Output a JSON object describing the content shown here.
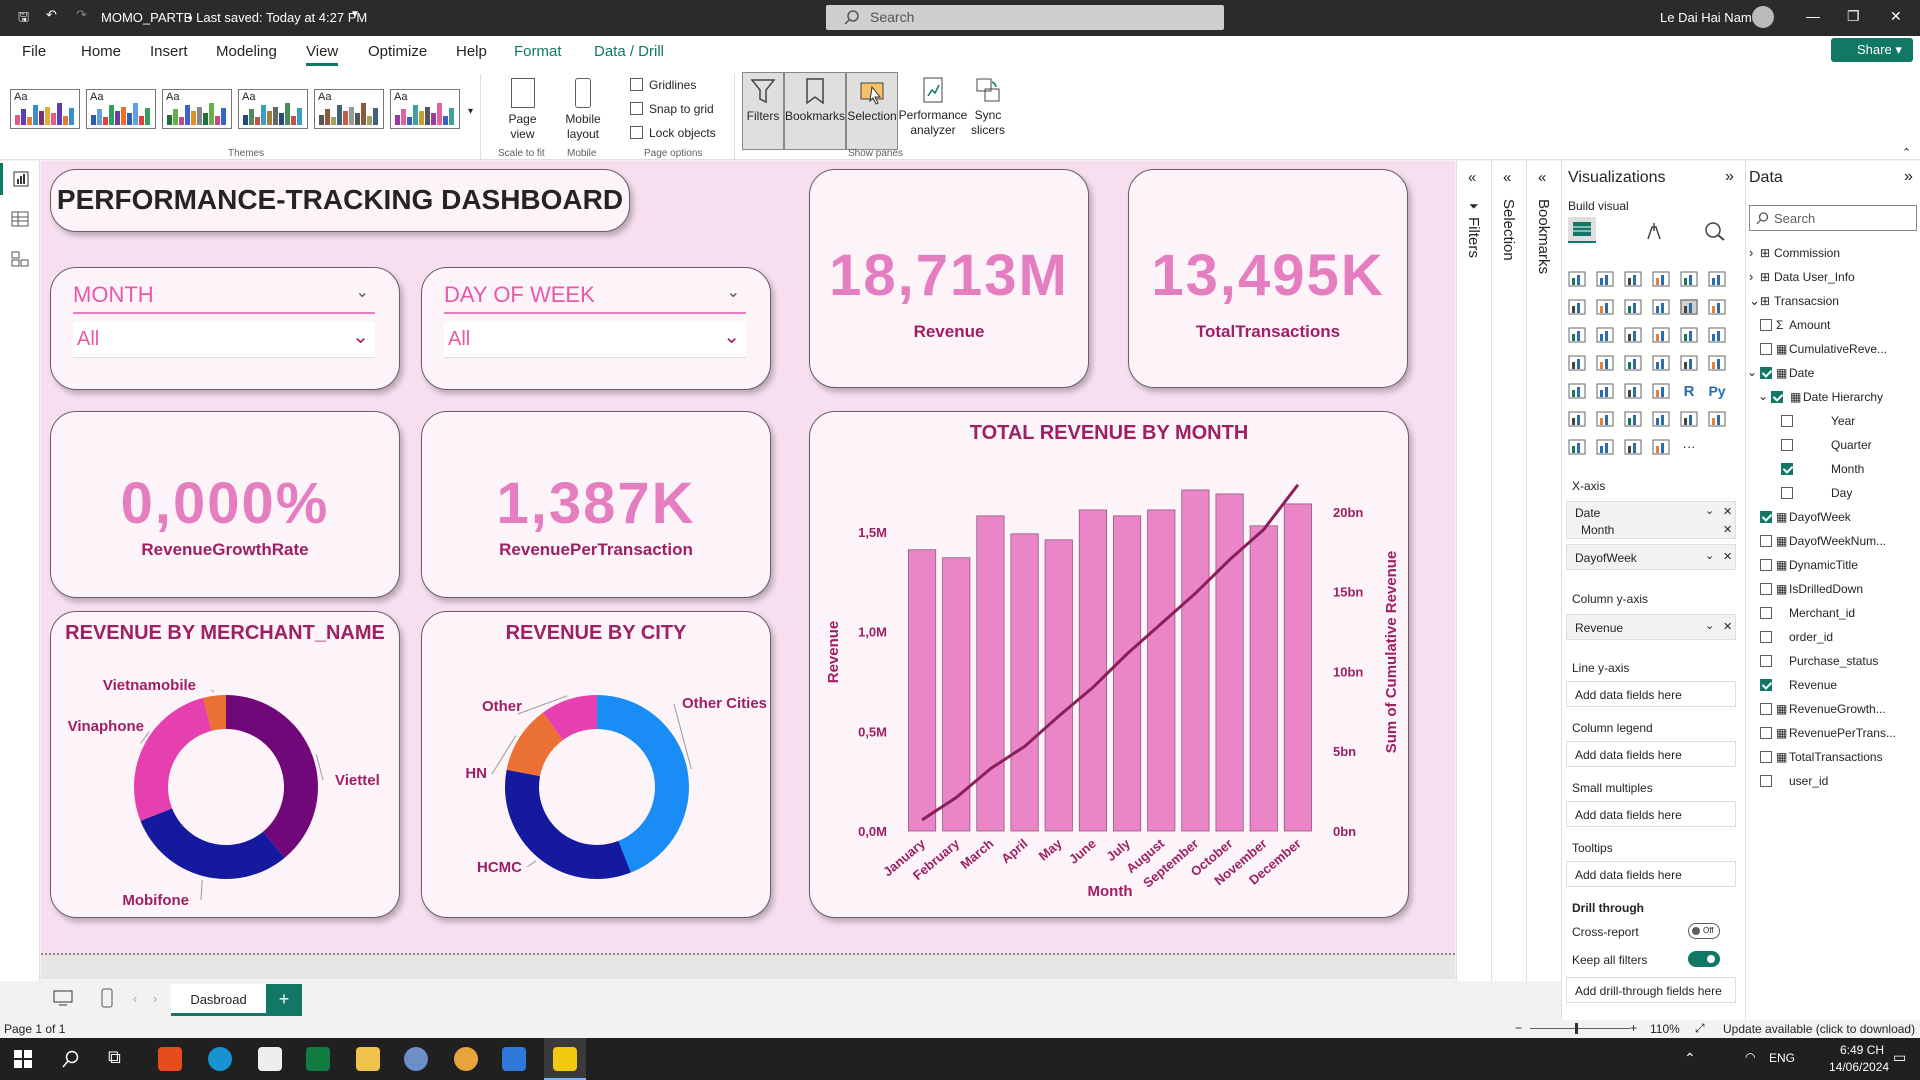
{
  "titlebar": {
    "doc": "MOMO_PARTB",
    "saved": "• Last saved: Today at 4:27 PM",
    "search": "Search",
    "user": "Le Dai Hai Nam"
  },
  "menu": [
    "File",
    "Home",
    "Insert",
    "Modeling",
    "View",
    "Optimize",
    "Help",
    "Format",
    "Data / Drill"
  ],
  "share": "Share",
  "ribbon": {
    "themes_label": "Themes",
    "page_view": "Page\nview",
    "mobile_layout": "Mobile\nlayout",
    "scale_label": "Scale to fit",
    "mobile_label": "Mobile",
    "gridlines": "Gridlines",
    "snap": "Snap to grid",
    "lock": "Lock objects",
    "page_options_label": "Page options",
    "filters": "Filters",
    "bookmarks": "Bookmarks",
    "selection": "Selection",
    "performance": "Performance\nanalyzer",
    "sync": "Sync\nslicers",
    "show_panes_label": "Show panes"
  },
  "dashboard": {
    "title": "PERFORMANCE-TRACKING DASHBOARD",
    "slicer_month": {
      "title": "MONTH",
      "value": "All"
    },
    "slicer_dow": {
      "title": "DAY OF WEEK",
      "value": "All"
    },
    "kpi_revenue": {
      "value": "18,713M",
      "label": "Revenue"
    },
    "kpi_transactions": {
      "value": "13,495K",
      "label": "TotalTransactions"
    },
    "kpi_growth": {
      "value": "0,000%",
      "label": "RevenueGrowthRate"
    },
    "kpi_per_tx": {
      "value": "1,387K",
      "label": "RevenuePerTransaction"
    },
    "merchant_title": "REVENUE BY MERCHANT_NAME",
    "city_title": "REVENUE BY CITY",
    "month_title": "TOTAL REVENUE BY MONTH"
  },
  "chart_data": [
    {
      "type": "bar",
      "title": "TOTAL REVENUE BY MONTH",
      "xlabel": "Month",
      "ylabel": "Revenue",
      "y2label": "Sum of Cumulative Revenue",
      "categories": [
        "January",
        "February",
        "March",
        "April",
        "May",
        "June",
        "July",
        "August",
        "September",
        "October",
        "November",
        "December"
      ],
      "series": [
        {
          "name": "Revenue",
          "type": "bar",
          "values": [
            1.41,
            1.37,
            1.58,
            1.49,
            1.46,
            1.61,
            1.58,
            1.61,
            1.71,
            1.69,
            1.53,
            1.64
          ],
          "color": "#ea86c8"
        },
        {
          "name": "Sum of Cumulative Revenue",
          "type": "line",
          "axis": "secondary",
          "values": [
            0.7,
            2.1,
            3.9,
            5.3,
            7.2,
            9.0,
            11.1,
            13.0,
            14.9,
            17.0,
            18.9,
            21.7
          ],
          "color": "#8b1e5b"
        }
      ],
      "ylim": [
        0,
        1.5
      ],
      "yticks": [
        "0,0M",
        "0,5M",
        "1,0M",
        "1,5M"
      ],
      "y2ticks": [
        "0bn",
        "5bn",
        "10bn",
        "15bn",
        "20bn"
      ],
      "legend": "none"
    },
    {
      "type": "pie",
      "title": "REVENUE BY MERCHANT_NAME",
      "labels": [
        "Viettel",
        "Mobifone",
        "Vinaphone",
        "Vietnamobile"
      ],
      "values": [
        39,
        30,
        27,
        4
      ],
      "colors": [
        "#70087a",
        "#14199e",
        "#e63fb0",
        "#ea7033"
      ]
    },
    {
      "type": "pie",
      "title": "REVENUE BY CITY",
      "labels": [
        "Other Cities",
        "HCMC",
        "HN",
        "Other"
      ],
      "values": [
        44,
        34,
        12,
        10
      ],
      "colors": [
        "#1a8cf5",
        "#14199e",
        "#ea7033",
        "#e63fb0"
      ],
      "extra_colors": [
        "#7a1182"
      ]
    }
  ],
  "tabs": {
    "page": "Dasbroad",
    "add": "+"
  },
  "status": {
    "page": "Page 1 of 1",
    "zoom": "110%",
    "update": "Update available (click to download)"
  },
  "panes": {
    "filters": "Filters",
    "selection": "Selection",
    "bookmarks": "Bookmarks"
  },
  "viz": {
    "title": "Visualizations",
    "build": "Build visual",
    "xaxis": "X-axis",
    "x1": "Date",
    "x1sub": "Month",
    "x2": "DayofWeek",
    "coly": "Column y-axis",
    "coly1": "Revenue",
    "liney": "Line y-axis",
    "add": "Add data fields here",
    "legend": "Column legend",
    "small": "Small multiples",
    "tooltips": "Tooltips",
    "drill": "Drill through",
    "cross": "Cross-report",
    "crossstate": "Off",
    "keep": "Keep all filters",
    "addDrill": "Add drill-through fields here"
  },
  "data": {
    "title": "Data",
    "search": "Search",
    "tables": [
      "Commission",
      "Data User_Info",
      "Transacsion"
    ],
    "fields": [
      "Amount",
      "CumulativeReve...",
      "Date",
      "Date Hierarchy",
      "Year",
      "Quarter",
      "Month",
      "Day",
      "DayofWeek",
      "DayofWeekNum...",
      "DynamicTitle",
      "IsDrilledDown",
      "Merchant_id",
      "order_id",
      "Purchase_status",
      "Revenue",
      "RevenueGrowth...",
      "RevenuePerTrans...",
      "TotalTransactions",
      "user_id"
    ]
  },
  "taskbar": {
    "lang": "ENG",
    "time": "6:49 CH",
    "date": "14/06/2024"
  }
}
